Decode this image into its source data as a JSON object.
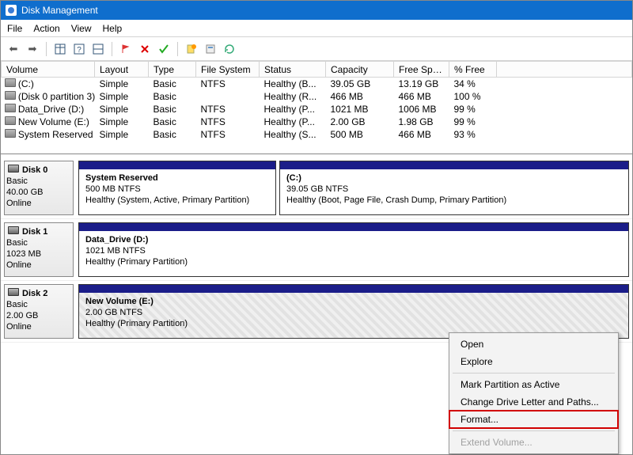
{
  "window": {
    "title": "Disk Management"
  },
  "menu": {
    "file": "File",
    "action": "Action",
    "view": "View",
    "help": "Help"
  },
  "columns": {
    "volume": "Volume",
    "layout": "Layout",
    "type": "Type",
    "fs": "File System",
    "status": "Status",
    "capacity": "Capacity",
    "free": "Free Spa...",
    "pct": "% Free"
  },
  "rows": [
    {
      "volume": "(C:)",
      "layout": "Simple",
      "type": "Basic",
      "fs": "NTFS",
      "status": "Healthy (B...",
      "capacity": "39.05 GB",
      "free": "13.19 GB",
      "pct": "34 %"
    },
    {
      "volume": "(Disk 0 partition 3)",
      "layout": "Simple",
      "type": "Basic",
      "fs": "",
      "status": "Healthy (R...",
      "capacity": "466 MB",
      "free": "466 MB",
      "pct": "100 %"
    },
    {
      "volume": "Data_Drive (D:)",
      "layout": "Simple",
      "type": "Basic",
      "fs": "NTFS",
      "status": "Healthy (P...",
      "capacity": "1021 MB",
      "free": "1006 MB",
      "pct": "99 %"
    },
    {
      "volume": "New Volume (E:)",
      "layout": "Simple",
      "type": "Basic",
      "fs": "NTFS",
      "status": "Healthy (P...",
      "capacity": "2.00 GB",
      "free": "1.98 GB",
      "pct": "99 %"
    },
    {
      "volume": "System Reserved",
      "layout": "Simple",
      "type": "Basic",
      "fs": "NTFS",
      "status": "Healthy (S...",
      "capacity": "500 MB",
      "free": "466 MB",
      "pct": "93 %"
    }
  ],
  "disk0": {
    "name": "Disk 0",
    "type": "Basic",
    "size": "40.00 GB",
    "state": "Online",
    "p1": {
      "name": "System Reserved",
      "meta": "500 MB NTFS",
      "stat": "Healthy (System, Active, Primary Partition)"
    },
    "p2": {
      "name": "(C:)",
      "meta": "39.05 GB NTFS",
      "stat": "Healthy (Boot, Page File, Crash Dump, Primary Partition)"
    }
  },
  "disk1": {
    "name": "Disk 1",
    "type": "Basic",
    "size": "1023 MB",
    "state": "Online",
    "p1": {
      "name": "Data_Drive  (D:)",
      "meta": "1021 MB NTFS",
      "stat": "Healthy (Primary Partition)"
    }
  },
  "disk2": {
    "name": "Disk 2",
    "type": "Basic",
    "size": "2.00 GB",
    "state": "Online",
    "p1": {
      "name": "New Volume  (E:)",
      "meta": "2.00 GB NTFS",
      "stat": "Healthy (Primary Partition)"
    }
  },
  "context": {
    "open": "Open",
    "explore": "Explore",
    "mark": "Mark Partition as Active",
    "change": "Change Drive Letter and Paths...",
    "format": "Format...",
    "extend": "Extend Volume..."
  }
}
